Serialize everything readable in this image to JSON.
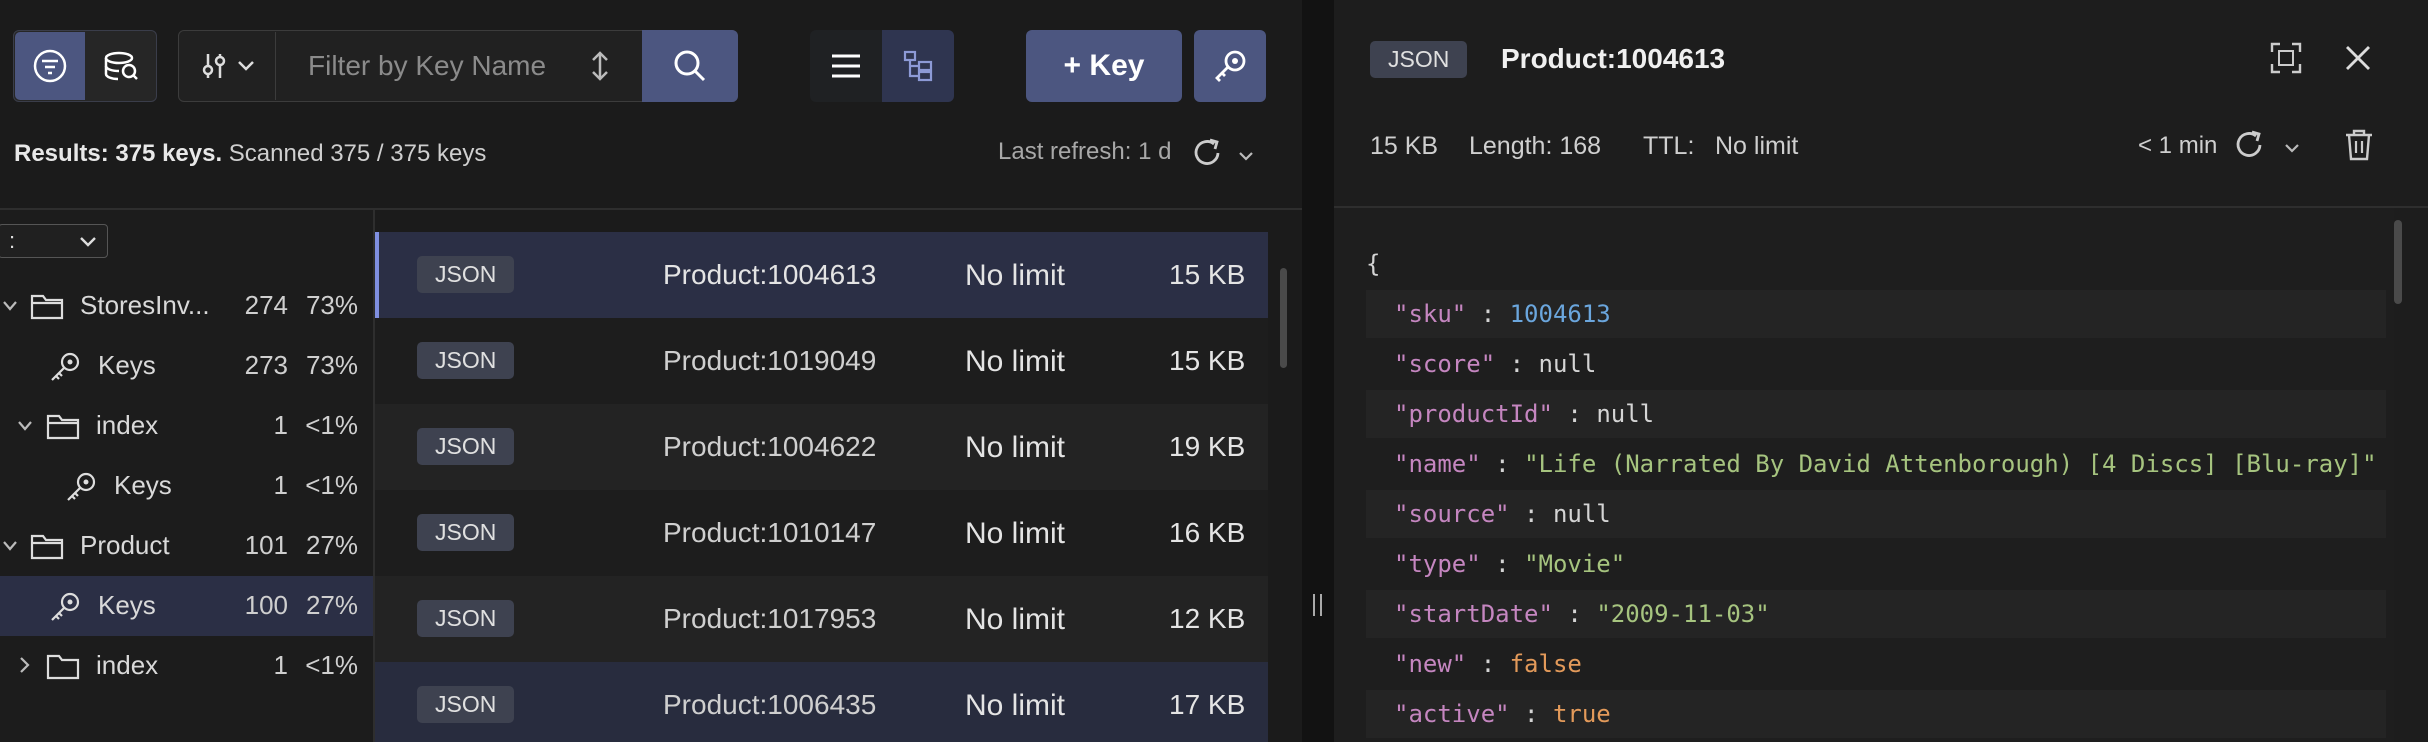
{
  "toolbar": {
    "filter_placeholder": "Filter by Key Name",
    "add_key_label": "+ Key"
  },
  "results": {
    "label": "Results: 375 keys.",
    "scanned": "Scanned 375 / 375 keys",
    "last_refresh_label": "Last refresh:",
    "last_refresh_value": "1 d"
  },
  "delimiter": {
    "value": ":"
  },
  "tree": [
    {
      "label": "StoresInv...",
      "count": "274",
      "percent": "73%",
      "type": "folder",
      "expanded": true
    },
    {
      "label": "Keys",
      "count": "273",
      "percent": "73%",
      "type": "keys"
    },
    {
      "label": "index",
      "count": "1",
      "percent": "<1%",
      "type": "folder",
      "expanded": true
    },
    {
      "label": "Keys",
      "count": "1",
      "percent": "<1%",
      "type": "keys"
    },
    {
      "label": "Product",
      "count": "101",
      "percent": "27%",
      "type": "folder",
      "expanded": true
    },
    {
      "label": "Keys",
      "count": "100",
      "percent": "27%",
      "type": "keys",
      "selected": true
    },
    {
      "label": "index",
      "count": "1",
      "percent": "<1%",
      "type": "folder",
      "expanded": false
    }
  ],
  "keys": [
    {
      "type": "JSON",
      "name": "Product:1004613",
      "ttl": "No limit",
      "size": "15 KB",
      "selected": true
    },
    {
      "type": "JSON",
      "name": "Product:1019049",
      "ttl": "No limit",
      "size": "15 KB"
    },
    {
      "type": "JSON",
      "name": "Product:1004622",
      "ttl": "No limit",
      "size": "19 KB"
    },
    {
      "type": "JSON",
      "name": "Product:1010147",
      "ttl": "No limit",
      "size": "16 KB"
    },
    {
      "type": "JSON",
      "name": "Product:1017953",
      "ttl": "No limit",
      "size": "12 KB"
    },
    {
      "type": "JSON",
      "name": "Product:1006435",
      "ttl": "No limit",
      "size": "17 KB",
      "highlighted": true
    }
  ],
  "details": {
    "type": "JSON",
    "key_name": "Product:1004613",
    "size": "15 KB",
    "length": "Length: 168",
    "ttl_label": "TTL:",
    "ttl_value": "No limit",
    "refresh": "< 1 min"
  },
  "json": {
    "open_brace": "{",
    "lines": [
      {
        "key": "\"sku\"",
        "value": "1004613",
        "kind": "num"
      },
      {
        "key": "\"score\"",
        "value": "null",
        "kind": "nul"
      },
      {
        "key": "\"productId\"",
        "value": "null",
        "kind": "nul"
      },
      {
        "key": "\"name\"",
        "value": "\"Life (Narrated By David Attenborough) [4 Discs] [Blu-ray]\"",
        "kind": "str"
      },
      {
        "key": "\"source\"",
        "value": "null",
        "kind": "nul"
      },
      {
        "key": "\"type\"",
        "value": "\"Movie\"",
        "kind": "str"
      },
      {
        "key": "\"startDate\"",
        "value": "\"2009-11-03\"",
        "kind": "str"
      },
      {
        "key": "\"new\"",
        "value": "false",
        "kind": "bool"
      },
      {
        "key": "\"active\"",
        "value": "true",
        "kind": "bool"
      }
    ]
  },
  "colors": {
    "accent": "#4c5680",
    "selected_row": "#2b2f45",
    "json_key": "#c586c0",
    "json_string": "#a6c47f",
    "json_number": "#6ba6dd",
    "json_bool": "#e39a5a"
  }
}
